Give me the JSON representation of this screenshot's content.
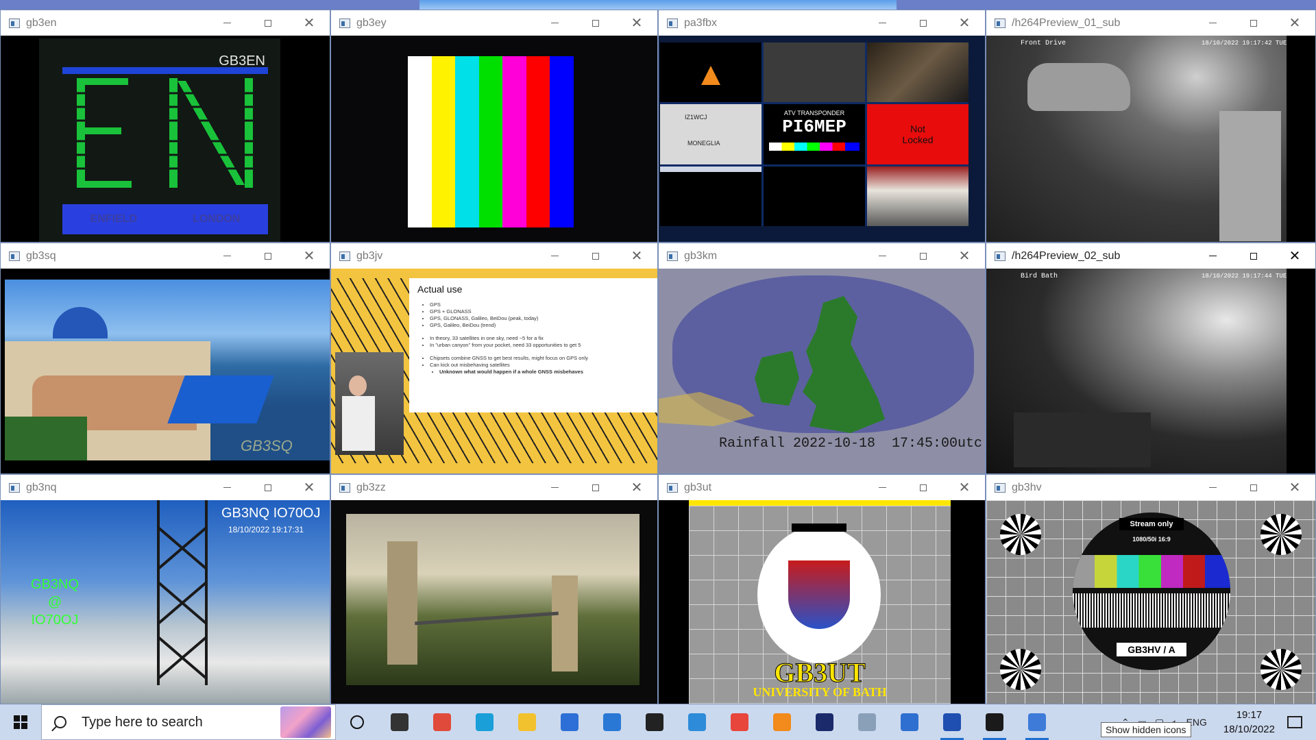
{
  "windows": [
    {
      "title": "gb3en",
      "active": false,
      "texts": [
        "GB3EN",
        "ENFIELD",
        "LONDON"
      ]
    },
    {
      "title": "gb3ey",
      "active": false,
      "bars": [
        "#ffffff",
        "#fff200",
        "#00e0e8",
        "#00e000",
        "#ff00d8",
        "#ff0000",
        "#0000ff"
      ]
    },
    {
      "title": "pa3fbx",
      "active": false,
      "texts": [
        "ATV TRANSPONDER",
        "PI6MEP",
        "Not",
        "Locked",
        "IZ1WCJ",
        "MONEGLIA"
      ]
    },
    {
      "title": "/h264Preview_01_sub",
      "active": false,
      "texts": [
        "Front Drive",
        "18/10/2022 19:17:42 TUE"
      ]
    },
    {
      "title": "gb3sq",
      "active": false,
      "texts": [
        "GB3SQ"
      ]
    },
    {
      "title": "gb3jv",
      "active": false,
      "slide": {
        "heading": "Actual use",
        "bullets": [
          "GPS",
          "GPS + GLONASS",
          "GPS, GLONASS, Galileo, BeiDou (peak, today)",
          "GPS, Galileo, BeiDou (trend)",
          "In theory, 33 satellites in one sky, need ~5 for a fix",
          "In \"urban canyon\" from your pocket, need 33 opportunities to get 5",
          "Chipsets combine GNSS to get best results, might focus on GPS only",
          "Can kick out misbehaving satellites",
          "Unknown what would happen if a whole GNSS misbehaves"
        ]
      }
    },
    {
      "title": "gb3km",
      "active": false,
      "texts": [
        "Rainfall 2022-10-18  17:45:00utc"
      ]
    },
    {
      "title": "/h264Preview_02_sub",
      "active": true,
      "texts": [
        "Bird Bath",
        "18/10/2022 19:17:44 TUE"
      ]
    },
    {
      "title": "gb3nq",
      "active": false,
      "texts": [
        "GB3NQ IO70OJ",
        "18/10/2022 19:17:31",
        "GB3NQ",
        "@",
        "IO70OJ"
      ]
    },
    {
      "title": "gb3zz",
      "active": false
    },
    {
      "title": "gb3ut",
      "active": false,
      "texts": [
        "GB3UT",
        "UNIVERSITY OF BATH"
      ]
    },
    {
      "title": "gb3hv",
      "active": false,
      "texts": [
        "Stream only",
        "1080/50i 16:9",
        "GB3HV / A"
      ]
    }
  ],
  "taskbar": {
    "search_placeholder": "Type here to search",
    "apps": [
      {
        "name": "task-view",
        "color": "#333333"
      },
      {
        "name": "store-grid",
        "color": "#e04a3a"
      },
      {
        "name": "edge",
        "color": "#1a9fd8"
      },
      {
        "name": "file-explorer",
        "color": "#f2c12e"
      },
      {
        "name": "microsoft-store",
        "color": "#2d6fd6"
      },
      {
        "name": "mail",
        "color": "#2a78d6"
      },
      {
        "name": "dell",
        "color": "#222222"
      },
      {
        "name": "news",
        "color": "#2e8bd9"
      },
      {
        "name": "chrome",
        "color": "#e8453c"
      },
      {
        "name": "vlc",
        "color": "#f28a1c"
      },
      {
        "name": "ndi",
        "color": "#1b2a6b"
      },
      {
        "name": "documents",
        "color": "#8aa0b8"
      },
      {
        "name": "app-window",
        "color": "#2f6fd0"
      },
      {
        "name": "video",
        "color": "#1f4fb0"
      },
      {
        "name": "terminal",
        "color": "#1a1a1a"
      },
      {
        "name": "viewer",
        "color": "#3e7bd8"
      }
    ],
    "tray_lang": "ENG",
    "time": "19:17",
    "date": "18/10/2022",
    "tooltip": "Show hidden icons"
  }
}
